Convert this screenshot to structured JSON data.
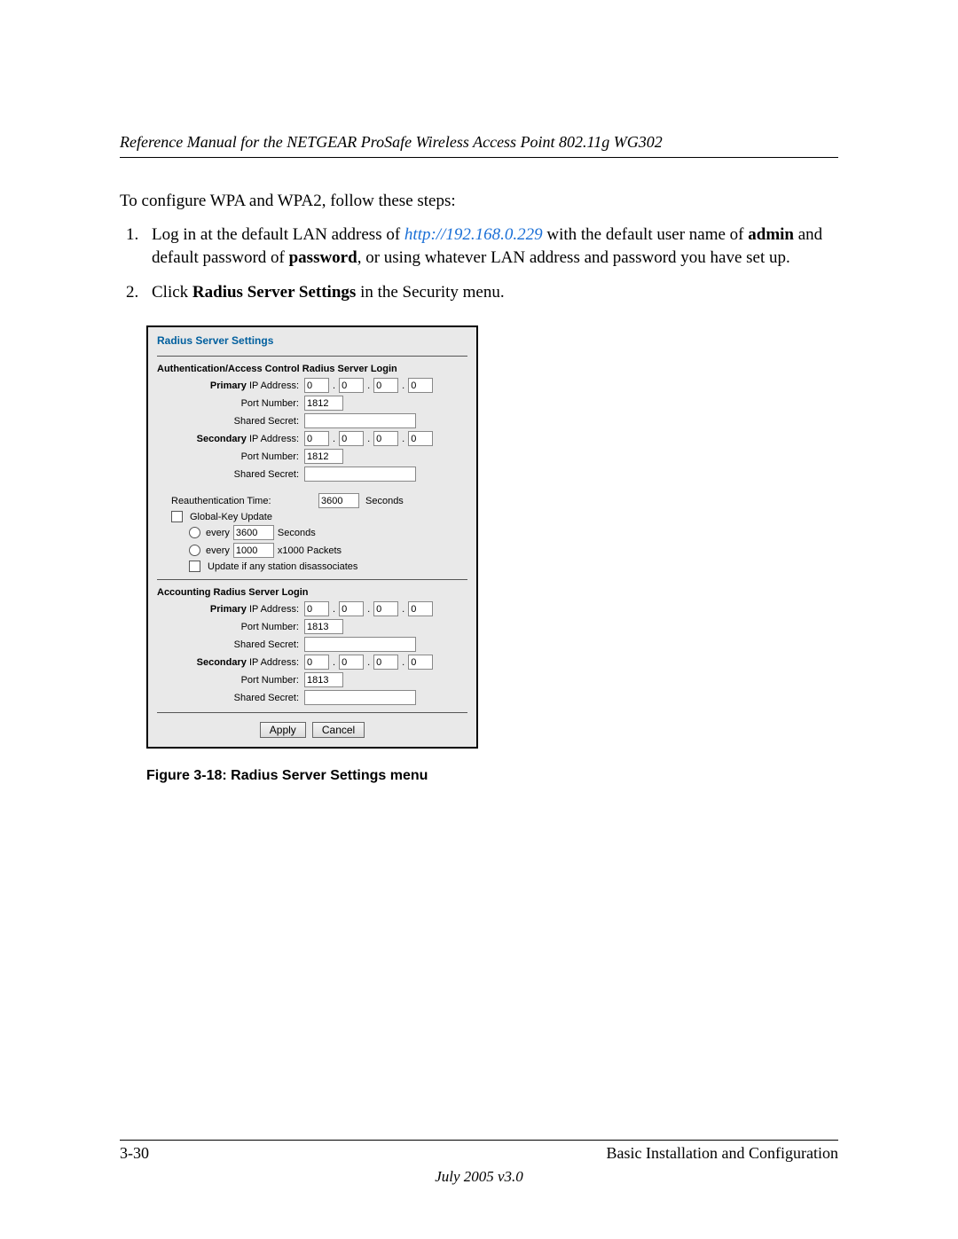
{
  "header": {
    "title": "Reference Manual for the NETGEAR ProSafe Wireless Access Point 802.11g WG302"
  },
  "intro": "To configure WPA and WPA2, follow these steps:",
  "steps": {
    "s1_a": "Log in at the default LAN address of ",
    "s1_link": "http://192.168.0.229",
    "s1_b": " with the default user name of ",
    "s1_admin": "admin",
    "s1_c": " and default password of ",
    "s1_pw": "password",
    "s1_d": ", or using whatever LAN address and password you have set up.",
    "s2_a": "Click ",
    "s2_b": "Radius Server Settings",
    "s2_c": " in the Security menu."
  },
  "panel": {
    "title": "Radius Server Settings",
    "auth_section": "Authentication/Access Control Radius Server Login",
    "acct_section": "Accounting Radius Server Login",
    "labels": {
      "primary_ip_b": "Primary",
      "primary_ip_rest": " IP Address:",
      "secondary_ip_b": "Secondary",
      "secondary_ip_rest": " IP Address:",
      "port": "Port Number:",
      "secret": "Shared Secret:",
      "reauth": "Reauthentication Time:",
      "global_key": "Global-Key Update",
      "every": "every",
      "seconds": "Seconds",
      "packets": "x1000 Packets",
      "update_disassoc": "Update if any station disassociates"
    },
    "values": {
      "ip_zero": "0",
      "auth_port": "1812",
      "acct_port": "1813",
      "reauth_time": "3600",
      "every_seconds": "3600",
      "every_packets": "1000"
    },
    "buttons": {
      "apply": "Apply",
      "cancel": "Cancel"
    }
  },
  "figure_caption": "Figure 3-18:  Radius Server Settings menu",
  "footer": {
    "page": "3-30",
    "section": "Basic Installation and Configuration",
    "version": "July 2005 v3.0"
  }
}
